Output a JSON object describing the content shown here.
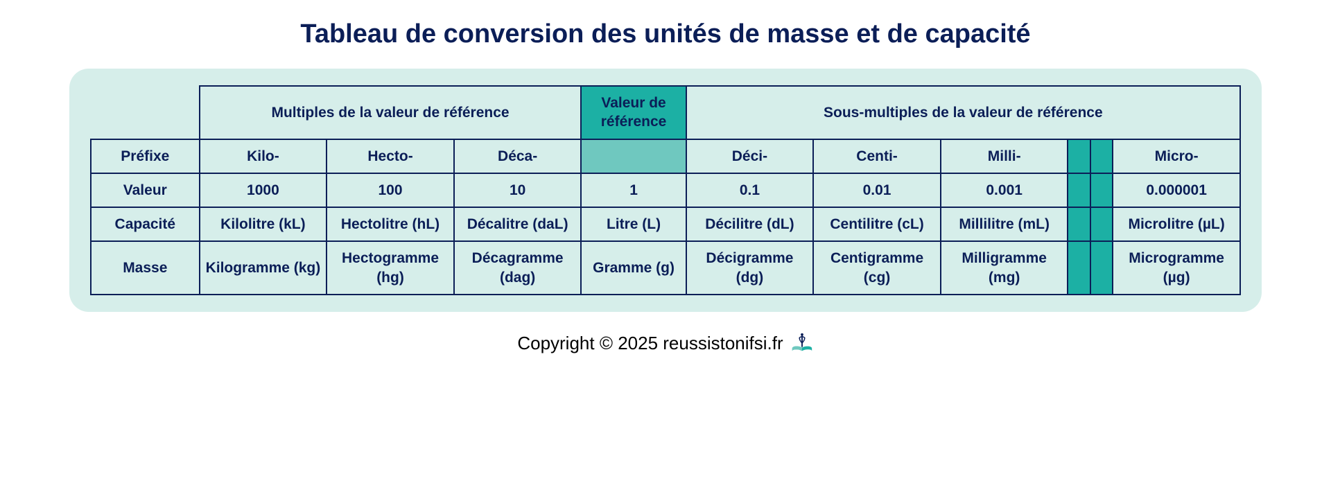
{
  "title": "Tableau de conversion des unités de masse et de capacité",
  "groups": {
    "multiples": "Multiples de la valeur de référence",
    "reference": "Valeur de référence",
    "submultiples": "Sous-multiples de la valeur de référence"
  },
  "rowLabels": {
    "prefix": "Préfixe",
    "value": "Valeur",
    "capacity": "Capacité",
    "mass": "Masse"
  },
  "columns": {
    "kilo": {
      "prefix": "Kilo-",
      "value": "1000",
      "capacity": "Kilolitre (kL)",
      "mass": "Kilogramme (kg)"
    },
    "hecto": {
      "prefix": "Hecto-",
      "value": "100",
      "capacity": "Hectolitre (hL)",
      "mass": "Hectogramme (hg)"
    },
    "deca": {
      "prefix": "Déca-",
      "value": "10",
      "capacity": "Décalitre (daL)",
      "mass": "Décagramme (dag)"
    },
    "ref": {
      "prefix": "",
      "value": "1",
      "capacity": "Litre (L)",
      "mass": "Gramme (g)"
    },
    "deci": {
      "prefix": "Déci-",
      "value": "0.1",
      "capacity": "Décilitre (dL)",
      "mass": "Décigramme (dg)"
    },
    "centi": {
      "prefix": "Centi-",
      "value": "0.01",
      "capacity": "Centilitre (cL)",
      "mass": "Centigramme (cg)"
    },
    "milli": {
      "prefix": "Milli-",
      "value": "0.001",
      "capacity": "Millilitre (mL)",
      "mass": "Milligramme (mg)"
    },
    "micro": {
      "prefix": "Micro-",
      "value": "0.000001",
      "capacity": "Microlitre (µL)",
      "mass": "Microgramme (µg)"
    }
  },
  "footer": "Copyright © 2025 reussistonifsi.fr",
  "chart_data": {
    "type": "table",
    "title": "Tableau de conversion des unités de masse et de capacité",
    "columns": [
      "Préfixe",
      "Valeur",
      "Capacité",
      "Masse"
    ],
    "rows": [
      {
        "Préfixe": "Kilo-",
        "Valeur": 1000,
        "Capacité": "Kilolitre (kL)",
        "Masse": "Kilogramme (kg)"
      },
      {
        "Préfixe": "Hecto-",
        "Valeur": 100,
        "Capacité": "Hectolitre (hL)",
        "Masse": "Hectogramme (hg)"
      },
      {
        "Préfixe": "Déca-",
        "Valeur": 10,
        "Capacité": "Décalitre (daL)",
        "Masse": "Décagramme (dag)"
      },
      {
        "Préfixe": "",
        "Valeur": 1,
        "Capacité": "Litre (L)",
        "Masse": "Gramme (g)"
      },
      {
        "Préfixe": "Déci-",
        "Valeur": 0.1,
        "Capacité": "Décilitre (dL)",
        "Masse": "Décigramme (dg)"
      },
      {
        "Préfixe": "Centi-",
        "Valeur": 0.01,
        "Capacité": "Centilitre (cL)",
        "Masse": "Centigramme (cg)"
      },
      {
        "Préfixe": "Milli-",
        "Valeur": 0.001,
        "Capacité": "Millilitre (mL)",
        "Masse": "Milligramme (mg)"
      },
      {
        "Préfixe": "Micro-",
        "Valeur": 1e-06,
        "Capacité": "Microlitre (µL)",
        "Masse": "Microgramme (µg)"
      }
    ]
  }
}
